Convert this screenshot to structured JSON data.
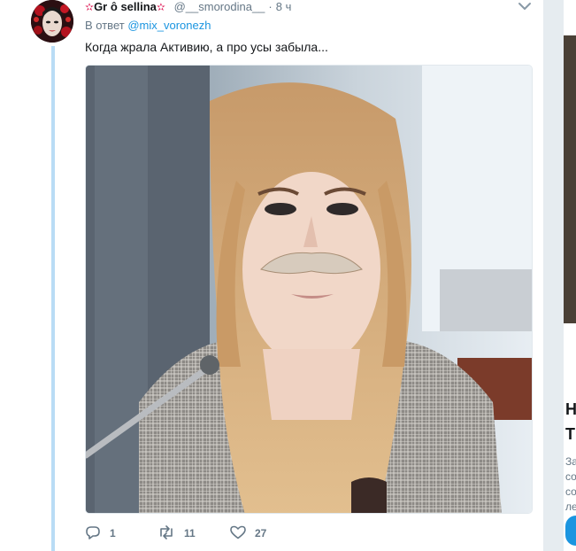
{
  "tweet": {
    "display_name_prefix": "Gr",
    "display_name_mid": "sellina",
    "star_left": "✫",
    "star_right": "✫",
    "ring": "ô",
    "handle": "@__smorodina__",
    "separator": "·",
    "time": "8 ч",
    "reply_prefix": "В ответ",
    "reply_to": "@mix_voronezh",
    "text": "Когда жрала Активию, а про усы забыла...",
    "media_icon": "photo",
    "actions": {
      "reply": {
        "icon": "reply-icon",
        "count": "1"
      },
      "retweet": {
        "icon": "retweet-icon",
        "count": "11"
      },
      "like": {
        "icon": "heart-icon",
        "count": "27"
      }
    }
  },
  "sidebar_card": {
    "heading_1": "Н",
    "heading_2": "Т",
    "lines": [
      "За",
      "со",
      "со",
      "ле"
    ]
  },
  "colors": {
    "link": "#1b95e0",
    "muted": "#657786",
    "thread_line": "#b9dcf5",
    "text": "#14171a"
  }
}
